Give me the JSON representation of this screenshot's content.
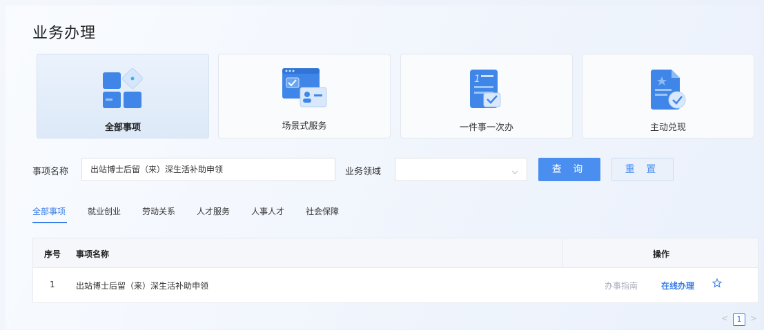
{
  "page": {
    "title": "业务办理"
  },
  "cards": [
    {
      "label": "全部事项",
      "icon": "grid-apps-icon",
      "active": true
    },
    {
      "label": "场景式服务",
      "icon": "scene-service-icon",
      "active": false
    },
    {
      "label": "一件事一次办",
      "icon": "checklist-icon",
      "active": false
    },
    {
      "label": "主动兑现",
      "icon": "document-check-icon",
      "active": false
    }
  ],
  "search": {
    "item_name_label": "事项名称",
    "item_name_value": "出站博士后留（来）深生活补助申领",
    "domain_label": "业务领域",
    "domain_value": "",
    "query_label": "查 询",
    "reset_label": "重 置"
  },
  "tabs": [
    {
      "label": "全部事项",
      "active": true
    },
    {
      "label": "就业创业"
    },
    {
      "label": "劳动关系"
    },
    {
      "label": "人才服务"
    },
    {
      "label": "人事人才"
    },
    {
      "label": "社会保障"
    }
  ],
  "table": {
    "headers": {
      "index": "序号",
      "name": "事项名称",
      "actions": "操作"
    },
    "rows": [
      {
        "index": "1",
        "name": "出站博士后留（来）深生活补助申领",
        "guide": "办事指南",
        "online": "在线办理"
      }
    ]
  },
  "pagination": {
    "prev": "<",
    "current": "1",
    "next": ">"
  },
  "colors": {
    "accent": "#4a8ff0",
    "active_text": "#3a7ee8"
  }
}
